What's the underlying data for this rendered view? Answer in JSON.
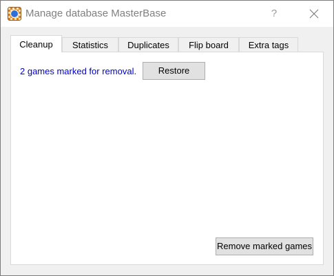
{
  "window": {
    "title": "Manage database MasterBase",
    "help_label": "?",
    "app_icon": "chess-knight-icon",
    "close_icon": "close-icon"
  },
  "tabs": [
    {
      "label": "Cleanup",
      "active": true
    },
    {
      "label": "Statistics",
      "active": false
    },
    {
      "label": "Duplicates",
      "active": false
    },
    {
      "label": "Flip board",
      "active": false
    },
    {
      "label": "Extra tags",
      "active": false
    }
  ],
  "cleanup": {
    "status_text": "2 games marked for removal.",
    "restore_label": "Restore",
    "remove_label": "Remove marked games"
  },
  "colors": {
    "status_text": "#0000cc",
    "button_face": "#e1e1e1",
    "panel_bg": "#ffffff",
    "window_bg": "#f0f0f0"
  }
}
